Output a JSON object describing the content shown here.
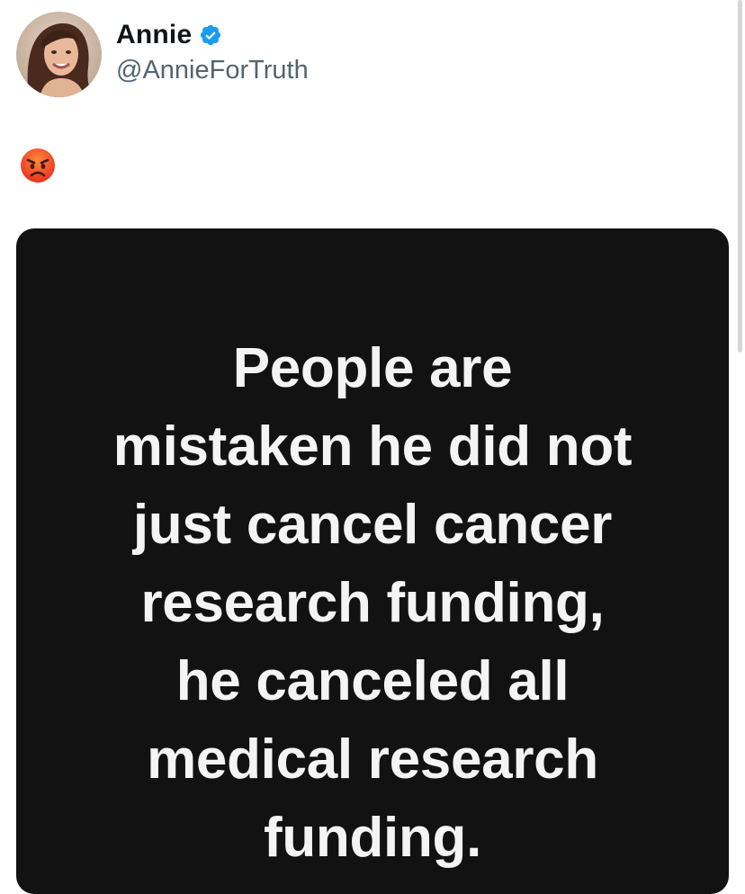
{
  "tweet": {
    "author": {
      "display_name": "Annie",
      "handle": "@AnnieForTruth",
      "verified": true,
      "verified_icon": "verified-badge-icon",
      "avatar": "profile-photo"
    },
    "text_emoji": "angry-face-emoji",
    "media": {
      "type": "text-image",
      "lines": [
        "People are",
        "mistaken he did not",
        "just cancel cancer",
        "research funding,",
        "he canceled all",
        "medical research",
        "funding."
      ]
    }
  },
  "colors": {
    "verified_blue": "#1d9bf0",
    "handle_gray": "#536471",
    "media_background": "#121212",
    "media_text": "#f4f4f4"
  }
}
